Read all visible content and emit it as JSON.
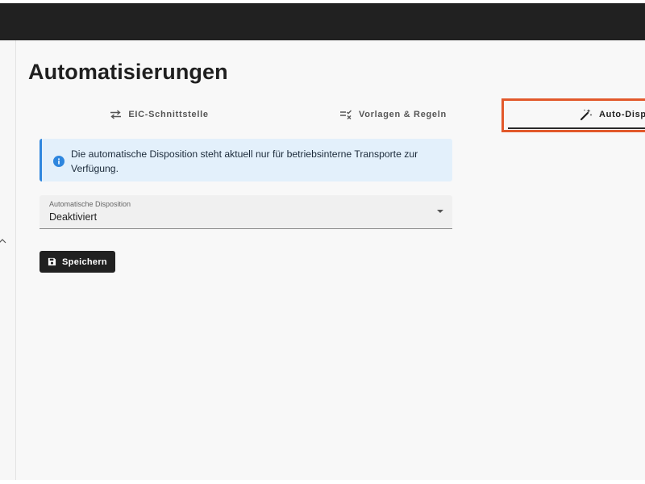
{
  "page": {
    "title": "Automatisierungen"
  },
  "tabs": [
    {
      "label": "EIC-Schnittstelle",
      "icon": "swap-horizontal-icon"
    },
    {
      "label": "Vorlagen & Regeln",
      "icon": "list-check-icon"
    },
    {
      "label": "Auto-Dispo",
      "icon": "magic-wand-icon",
      "active": true
    }
  ],
  "alert": {
    "icon": "info-icon",
    "text": "Die automatische Disposition steht aktuell nur für betriebsinterne Transporte zur Verfügung."
  },
  "disposition_select": {
    "label": "Automatische Disposition",
    "value": "Deaktiviert"
  },
  "actions": {
    "save_label": "Speichern",
    "save_icon": "save-icon"
  },
  "colors": {
    "topbar": "#212121",
    "accent": "#2e86de",
    "highlight": "#e2592b",
    "background": "#f8f8f8"
  }
}
